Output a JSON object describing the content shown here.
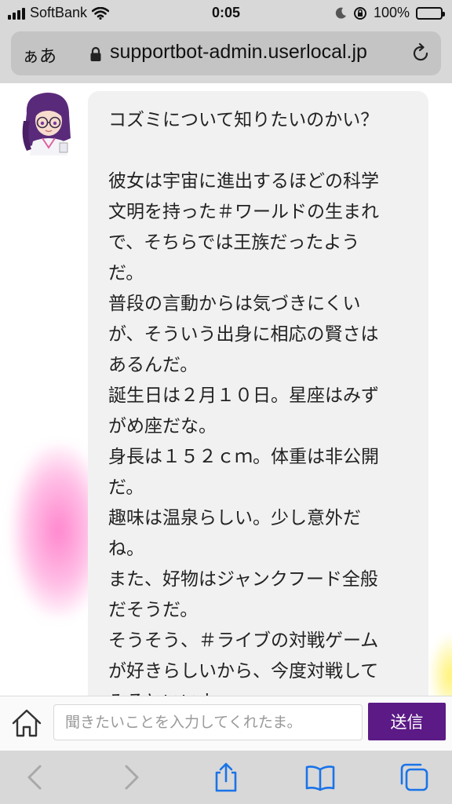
{
  "status_bar": {
    "carrier": "SoftBank",
    "time": "0:05",
    "battery": "100%",
    "icons": [
      "signal-icon",
      "wifi-icon",
      "moon-icon",
      "rotation-lock-icon",
      "battery-icon"
    ]
  },
  "browser": {
    "text_size_button": "ぁあ",
    "url": "supportbot-admin.userlocal.jp",
    "icons": [
      "lock-icon",
      "reload-icon"
    ]
  },
  "chat": {
    "message_lines": [
      "コズミについて知りたいのかい？",
      "",
      "彼女は宇宙に進出するほどの科学",
      "文明を持った＃ワールドの生まれ",
      "で、そちらでは王族だったよう",
      "だ。",
      "普段の言動からは気づきにくい",
      "が、そういう出身に相応の賢さは",
      "あるんだ。",
      "誕生日は２月１０日。星座はみず",
      "がめ座だな。",
      "身長は１５２ｃｍ。体重は非公開",
      "だ。",
      "趣味は温泉らしい。少し意外だ",
      "ね。",
      "また、好物はジャンクフード全般",
      "だそうだ。",
      "そうそう、＃ライブの対戦ゲーム",
      "が好きらしいから、今度対戦して",
      "みるといいよ。"
    ]
  },
  "input_bar": {
    "placeholder": "聞きたいことを入力してくれたま。",
    "send_label": "送信",
    "send_color": "#5b1a86"
  },
  "toolbar": {
    "icons": [
      "back-icon",
      "forward-icon",
      "share-icon",
      "bookmarks-icon",
      "tabs-icon"
    ],
    "accent": "#1a73e8"
  }
}
